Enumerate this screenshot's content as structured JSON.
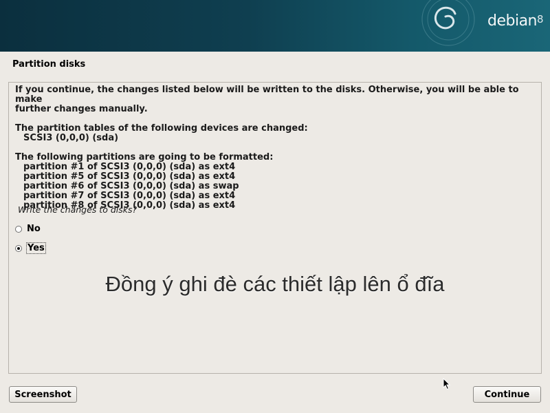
{
  "header": {
    "brand": "debian",
    "version": "8"
  },
  "page": {
    "title": "Partition disks"
  },
  "message": {
    "line1": "If you continue, the changes listed below will be written to the disks. Otherwise, you will be able to make",
    "line2": "further changes manually.",
    "tables_heading": "The partition tables of the following devices are changed:",
    "devices": [
      "SCSI3 (0,0,0) (sda)"
    ],
    "format_heading": "The following partitions are going to be formatted:",
    "partitions": [
      "partition #1 of SCSI3 (0,0,0) (sda) as ext4",
      "partition #5 of SCSI3 (0,0,0) (sda) as ext4",
      "partition #6 of SCSI3 (0,0,0) (sda) as swap",
      "partition #7 of SCSI3 (0,0,0) (sda) as ext4",
      "partition #8 of SCSI3 (0,0,0) (sda) as ext4"
    ]
  },
  "question": "Write the changes to disks?",
  "options": [
    {
      "label": "No",
      "selected": false
    },
    {
      "label": "Yes",
      "selected": true
    }
  ],
  "overlay_text": "Đồng ý ghi đè các thiết lập lên ổ đĩa",
  "buttons": {
    "screenshot": "Screenshot",
    "continue": "Continue"
  },
  "colors": {
    "header_dark": "#0b2f3e",
    "header_light": "#1a6677",
    "background": "#edeae5"
  }
}
